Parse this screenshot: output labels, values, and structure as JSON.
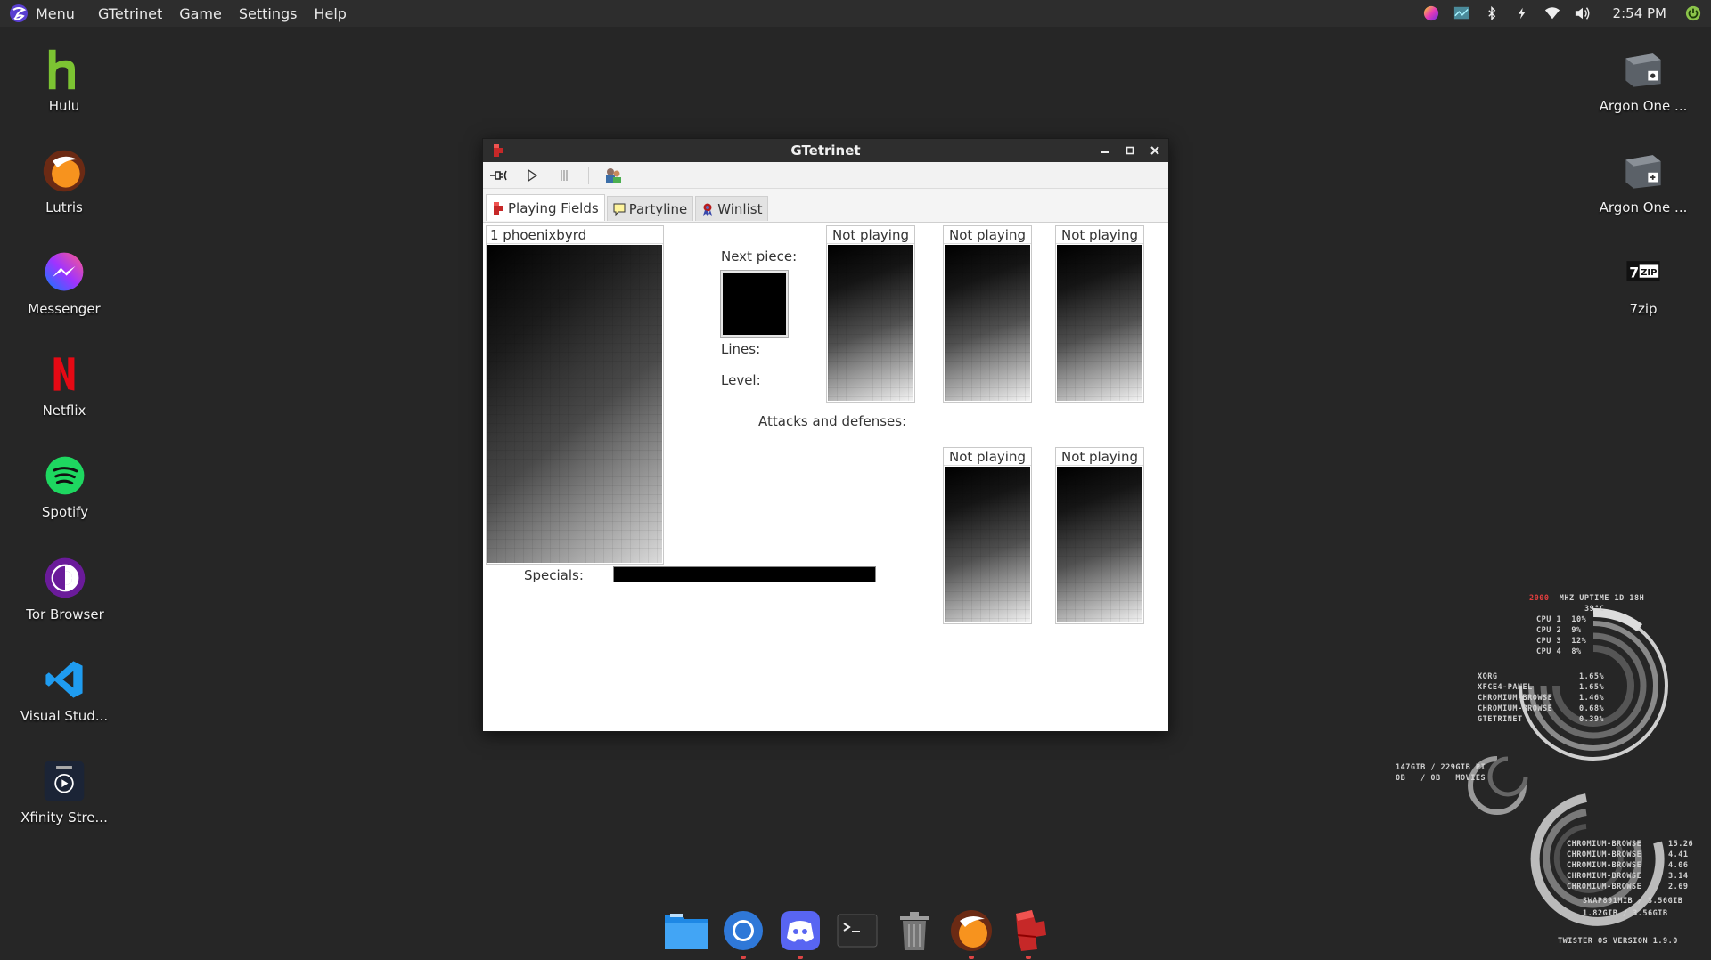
{
  "topbar": {
    "menu_label": "Menu",
    "app_menu": [
      "GTetrinet",
      "Game",
      "Settings",
      "Help"
    ],
    "clock": "2:54 PM"
  },
  "desktop_left": [
    {
      "label": "Hulu",
      "icon": "hulu-icon"
    },
    {
      "label": "Lutris",
      "icon": "lutris-icon"
    },
    {
      "label": "Messenger",
      "icon": "messenger-icon"
    },
    {
      "label": "Netflix",
      "icon": "netflix-icon"
    },
    {
      "label": "Spotify",
      "icon": "spotify-icon"
    },
    {
      "label": "Tor Browser",
      "icon": "tor-browser-icon"
    },
    {
      "label": "Visual Stud...",
      "icon": "vscode-icon"
    },
    {
      "label": "Xfinity Stre...",
      "icon": "xfinity-icon"
    }
  ],
  "desktop_right": [
    {
      "label": "Argon One ...",
      "icon": "argon-one-icon"
    },
    {
      "label": "Argon One ...",
      "icon": "argon-one-icon"
    },
    {
      "label": "7zip",
      "icon": "7zip-icon"
    }
  ],
  "window": {
    "title": "GTetrinet",
    "tabs": [
      {
        "label": "Playing Fields",
        "active": true
      },
      {
        "label": "Partyline",
        "active": false
      },
      {
        "label": "Winlist",
        "active": false
      }
    ],
    "main_field": {
      "header": "1  phoenixbyrd"
    },
    "next_piece_label": "Next piece:",
    "lines_label": "Lines:",
    "level_label": "Level:",
    "attacks_label": "Attacks and defenses:",
    "specials_label": "Specials:",
    "other_fields": [
      "Not playing",
      "Not playing",
      "Not playing",
      "Not playing",
      "Not playing"
    ]
  },
  "dock": [
    "file-manager-icon",
    "chromium-icon",
    "discord-icon",
    "terminal-icon",
    "trash-icon",
    "lutris-icon",
    "gtetrinet-icon"
  ],
  "conky": {
    "freq_mhz": "2000",
    "freq_unit": "MHZ",
    "uptime": "UPTIME 1D 18H",
    "temp": "39°C",
    "cpus": [
      {
        "label": "CPU 1",
        "value": "10%"
      },
      {
        "label": "CPU 2",
        "value": "9%"
      },
      {
        "label": "CPU 3",
        "value": "12%"
      },
      {
        "label": "CPU 4",
        "value": "8%"
      }
    ],
    "processes": [
      {
        "name": "XORG",
        "value": "1.65%"
      },
      {
        "name": "XFCE4-PANEL",
        "value": "1.65%"
      },
      {
        "name": "CHROMIUM-BROWSE",
        "value": "1.46%"
      },
      {
        "name": "CHROMIUM-BROWSE",
        "value": "0.68%"
      },
      {
        "name": "GTETRINET",
        "value": "0.39%"
      }
    ],
    "disk1": "147GIB / 229GIB PI",
    "disk2": "0B   / 0B   MOVIES",
    "mem_processes": [
      {
        "name": "CHROMIUM-BROWSE",
        "value": "15.26"
      },
      {
        "name": "CHROMIUM-BROWSE",
        "value": "4.41"
      },
      {
        "name": "CHROMIUM-BROWSE",
        "value": "4.06"
      },
      {
        "name": "CHROMIUM-BROWSE",
        "value": "3.14"
      },
      {
        "name": "CHROMIUM-BROWSE",
        "value": "2.69"
      }
    ],
    "swap": "SWAP891MIB / 3.56GIB",
    "ram": "1.82GIB / 3.56GIB",
    "os_version": "TWISTER OS VERSION 1.9.0"
  }
}
